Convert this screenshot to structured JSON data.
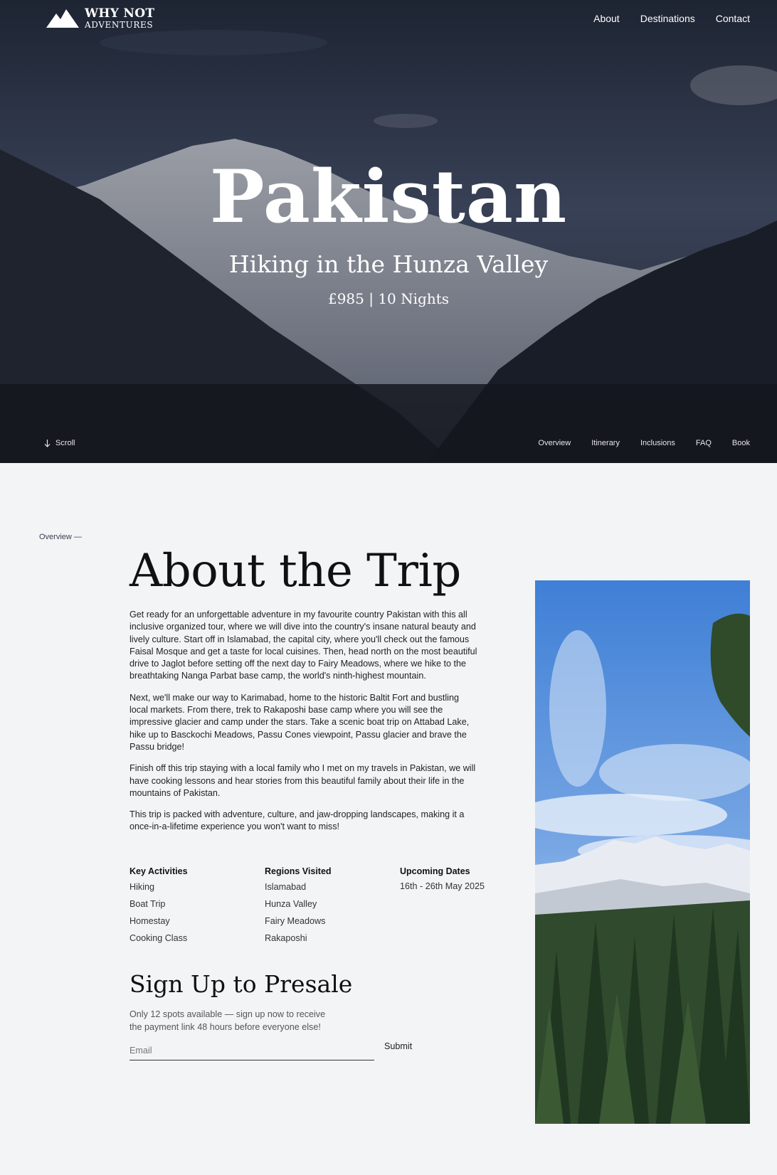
{
  "brand": {
    "name_top": "WHY NOT",
    "name_bottom": "ADVENTURES"
  },
  "nav": {
    "items": [
      "About",
      "Destinations",
      "Contact"
    ]
  },
  "hero": {
    "title": "Pakistan",
    "subtitle": "Hiking in the Hunza Valley",
    "price_duration": "£985 | 10 Nights",
    "scroll_label": "Scroll"
  },
  "subnav": {
    "items": [
      "Overview",
      "Itinerary",
      "Inclusions",
      "FAQ",
      "Book"
    ]
  },
  "overview": {
    "section_label": "Overview —",
    "heading": "About the Trip",
    "paragraphs": [
      "Get ready for an unforgettable adventure in my favourite country Pakistan with this all inclusive organized tour, where we will dive into the country's insane natural beauty and lively culture. Start off in Islamabad, the capital city, where you'll check out the famous Faisal Mosque and get a taste for local cuisines. Then, head north on the most beautiful drive to Jaglot before setting off the next day to Fairy Meadows, where we hike to the breathtaking Nanga Parbat base camp, the world's ninth-highest mountain.",
      "Next, we'll make our way to Karimabad, home to the historic Baltit Fort and bustling local markets. From there, trek to Rakaposhi base camp where you will see the impressive glacier and camp under the stars. Take a scenic boat trip on Attabad Lake, hike up to Basckochi Meadows, Passu Cones viewpoint, Passu glacier and brave the Passu bridge!",
      "Finish off this trip staying with a local family who I met on my travels in Pakistan, we will have cooking lessons and hear stories from this beautiful family about their life in the mountains of Pakistan.",
      "This trip is packed with adventure, culture, and jaw-dropping landscapes, making it a once-in-a-lifetime experience you won't want to miss!"
    ],
    "facts": {
      "activities": {
        "heading": "Key Activities",
        "items": [
          "Hiking",
          "Boat Trip",
          "Homestay",
          "Cooking Class"
        ]
      },
      "regions": {
        "heading": "Regions Visited",
        "items": [
          "Islamabad",
          "Hunza Valley",
          "Fairy Meadows",
          "Rakaposhi"
        ]
      },
      "dates": {
        "heading": "Upcoming Dates",
        "items": [
          "16th - 26th May 2025"
        ]
      }
    }
  },
  "presale": {
    "heading": "Sign Up to Presale",
    "copy": "Only 12 spots available — sign up now to receive the payment link 48 hours before everyone else!",
    "email_placeholder": "Email",
    "email_value": "",
    "submit_label": "Submit"
  },
  "icons": {
    "logo": "mountain-logo-icon",
    "scroll": "arrow-down-icon"
  },
  "colors": {
    "page_bg": "#f3f4f6",
    "hero_overlay": "#1f2533",
    "text": "#222222"
  }
}
